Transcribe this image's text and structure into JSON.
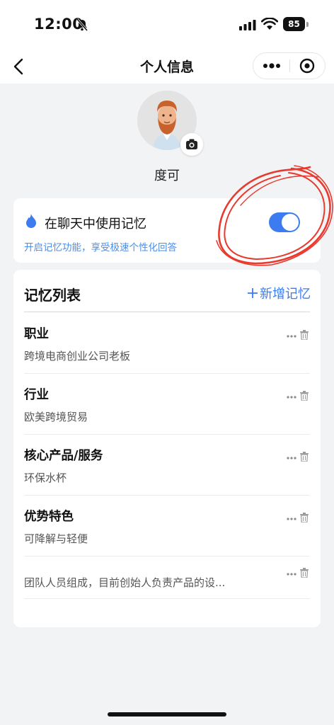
{
  "status": {
    "time": "12:00",
    "battery": "85",
    "icons": [
      "bell-slash-icon",
      "cellular-signal-icon",
      "wifi-icon",
      "battery-icon"
    ]
  },
  "nav": {
    "title": "个人信息",
    "back_icon": "chevron-left-icon",
    "more_icon": "more-dots-icon",
    "close_icon": "target-circle-icon"
  },
  "profile": {
    "name": "度可",
    "avatar_icon": "cartoon-man-avatar",
    "camera_icon": "camera-icon"
  },
  "memory_toggle": {
    "title": "在聊天中使用记忆",
    "subtitle": "开启记忆功能，享受极速个性化回答",
    "enabled": true,
    "icon": "flame-icon",
    "accent": "#3d7cf0"
  },
  "memory_list": {
    "title": "记忆列表",
    "add_label": "新增记忆",
    "items": [
      {
        "label": "职业",
        "value": "跨境电商创业公司老板"
      },
      {
        "label": "行业",
        "value": "欧美跨境贸易"
      },
      {
        "label": "核心产品/服务",
        "value": "环保水杯"
      },
      {
        "label": "优势特色",
        "value": "可降解与轻便"
      },
      {
        "label": "",
        "value": "团队人员组成，目前创始人负责产品的设..."
      }
    ]
  },
  "colors": {
    "accent": "#3d7cf0",
    "subtitle_blue": "#4a8ee8",
    "annotation_red": "#e83a2e",
    "background": "#f2f3f5"
  }
}
